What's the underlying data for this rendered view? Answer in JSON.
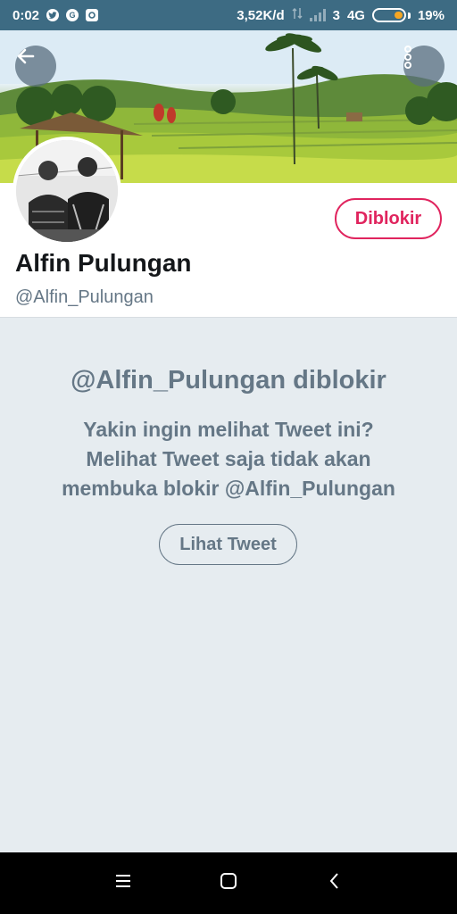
{
  "status_bar": {
    "time": "0:02",
    "notification_icons": [
      "twitter-icon",
      "google-icon",
      "app-icon"
    ],
    "network_speed": "3,52K/d",
    "sim_label": "3",
    "network_type": "4G",
    "battery_percent": "19%",
    "battery_level": 0.19,
    "battery_color": "#f5a623"
  },
  "header": {
    "back_icon": "arrow-left-icon",
    "menu_icon": "more-vertical-icon"
  },
  "profile": {
    "display_name": "Alfin Pulungan",
    "handle": "@Alfin_Pulungan",
    "blocked_button_label": "Diblokir"
  },
  "blocked_notice": {
    "title": "@Alfin_Pulungan diblokir",
    "line_1": "Yakin ingin melihat Tweet ini?",
    "line_2": "Melihat Tweet saja tidak akan",
    "line_3": "membuka blokir @Alfin_Pulungan",
    "view_button_label": "Lihat Tweet"
  },
  "nav_bar": {
    "icons": [
      "menu-icon",
      "home-square-icon",
      "back-chevron-icon"
    ]
  },
  "colors": {
    "accent_blocked": "#e0245e",
    "secondary_text": "#657786",
    "background": "#e6ecf0",
    "status_bar": "#3d6b83"
  }
}
